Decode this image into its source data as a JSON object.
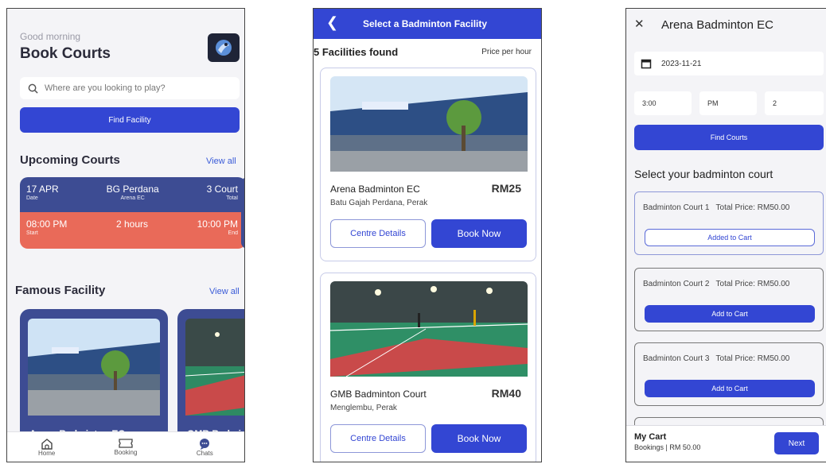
{
  "home": {
    "greeting": "Good morning",
    "title": "Book Courts",
    "search_placeholder": "Where are you looking to play?",
    "find_button": "Find Facility",
    "upcoming": {
      "title": "Upcoming Courts",
      "view_all": "View all",
      "card": {
        "date": "17 APR",
        "date_label": "Date",
        "venue": "BG Perdana",
        "venue_sub": "Arena EC",
        "courts": "3 Court",
        "courts_label": "Total",
        "start": "08:00 PM",
        "start_label": "Start",
        "duration": "2 hours",
        "end": "10:00 PM",
        "end_label": "End"
      }
    },
    "famous": {
      "title": "Famous Facility",
      "view_all": "View all",
      "facilities": [
        "Arena Badminton EC",
        "GMB Badmi"
      ]
    },
    "tabs": [
      {
        "label": "Home",
        "icon": "home-icon"
      },
      {
        "label": "Booking",
        "icon": "ticket-icon"
      },
      {
        "label": "Chats",
        "icon": "chat-icon"
      }
    ]
  },
  "facilities": {
    "header_title": "Select a Badminton Facility",
    "found": "5 Facilities found",
    "price_label": "Price per hour",
    "items": [
      {
        "name": "Arena Badminton EC",
        "location": "Batu Gajah Perdana, Perak",
        "price": "RM25",
        "details": "Centre Details",
        "book": "Book Now"
      },
      {
        "name": "GMB Badminton Court",
        "location": "Menglembu, Perak",
        "price": "RM40",
        "details": "Centre Details",
        "book": "Book Now"
      }
    ]
  },
  "booking": {
    "title": "Arena Badminton EC",
    "date": "2023-11-21",
    "time": "3:00",
    "ampm": "PM",
    "hours": "2",
    "find_button": "Find Courts",
    "select_title": "Select your badminton court",
    "courts": [
      {
        "name": "Badminton Court 1",
        "price": "Total Price: RM50.00",
        "action": "Added to Cart",
        "added": true
      },
      {
        "name": "Badminton Court 2",
        "price": "Total Price: RM50.00",
        "action": "Add to Cart",
        "added": false
      },
      {
        "name": "Badminton Court 3",
        "price": "Total Price: RM50.00",
        "action": "Add to Cart",
        "added": false
      }
    ],
    "cart": {
      "title": "My Cart",
      "summary": "Bookings | RM 50.00",
      "next": "Next"
    }
  },
  "colors": {
    "primary": "#3346d3",
    "navy": "#3d4c93",
    "coral": "#e96a59"
  }
}
